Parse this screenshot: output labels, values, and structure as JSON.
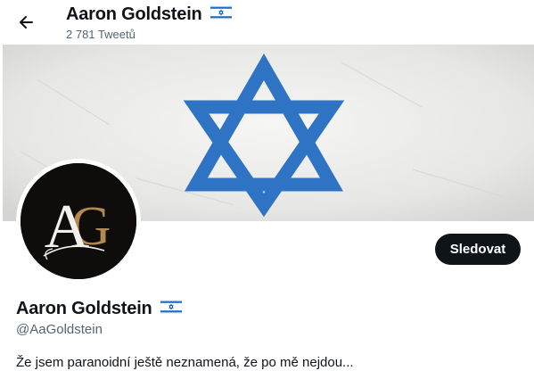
{
  "header": {
    "display_name": "Aaron Goldstein",
    "tweet_count": "2 781 Tweetů"
  },
  "profile": {
    "display_name": "Aaron Goldstein",
    "handle": "@AaGoldstein",
    "bio": "Že jsem paranoidní ještě neznamená, že po mě nejdou...",
    "follow_label": "Sledovat",
    "avatar_letters": {
      "first": "A",
      "second": "G"
    }
  },
  "icons": {
    "back": "back-arrow-icon",
    "name_badge": "israel-flag-icon"
  },
  "colors": {
    "flag_blue": "#1f6dc2",
    "banner_bg": "#ebebea",
    "avatar_bg": "#0e0d0c",
    "avatar_gold": "#b08a4e",
    "follow_button_bg": "#0f1419",
    "secondary_text": "#536471"
  }
}
